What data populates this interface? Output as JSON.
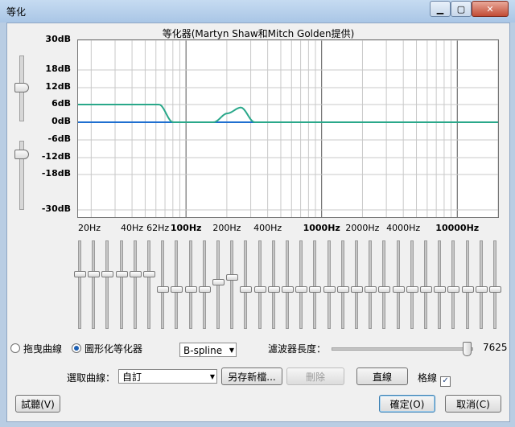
{
  "window": {
    "title": "等化"
  },
  "graph": {
    "title": "等化器(Martyn Shaw和Mitch Golden提供)",
    "y_labels": [
      "30dB",
      "18dB",
      "12dB",
      "6dB",
      "0dB",
      "-6dB",
      "-12dB",
      "-18dB",
      "-30dB"
    ],
    "x_labels": [
      "20Hz",
      "40Hz",
      "62Hz",
      "100Hz",
      "200Hz",
      "400Hz",
      "1000Hz",
      "2000Hz",
      "4000Hz",
      "10000Hz"
    ],
    "bold_x_labels": [
      "100Hz",
      "1000Hz",
      "10000Hz"
    ],
    "line_color": "#1f6fd0",
    "curve_color": "#2aa88a"
  },
  "eq_bands_db": [
    6,
    6,
    6,
    6,
    6,
    6,
    0,
    0,
    0,
    0,
    3,
    5,
    0,
    0,
    0,
    0,
    0,
    0,
    0,
    0,
    0,
    0,
    0,
    0,
    0,
    0,
    0,
    0,
    0,
    0,
    0
  ],
  "mode": {
    "draw_label": "拖曳曲線",
    "graphic_label": "圖形化等化器",
    "selected": "graphic"
  },
  "interp_select": {
    "value": "B-spline"
  },
  "filter_length": {
    "label": "濾波器長度：",
    "value": "7625",
    "fraction": 0.96
  },
  "curve_row": {
    "label": "選取曲線：",
    "value": "自訂",
    "save_as_label": "另存新檔...",
    "delete_label": "刪除",
    "flat_label": "直線",
    "grid_label": "格線",
    "grid_checked": true
  },
  "footer": {
    "preview_label": "試聽(V)",
    "ok_label": "確定(O)",
    "cancel_label": "取消(C)"
  }
}
